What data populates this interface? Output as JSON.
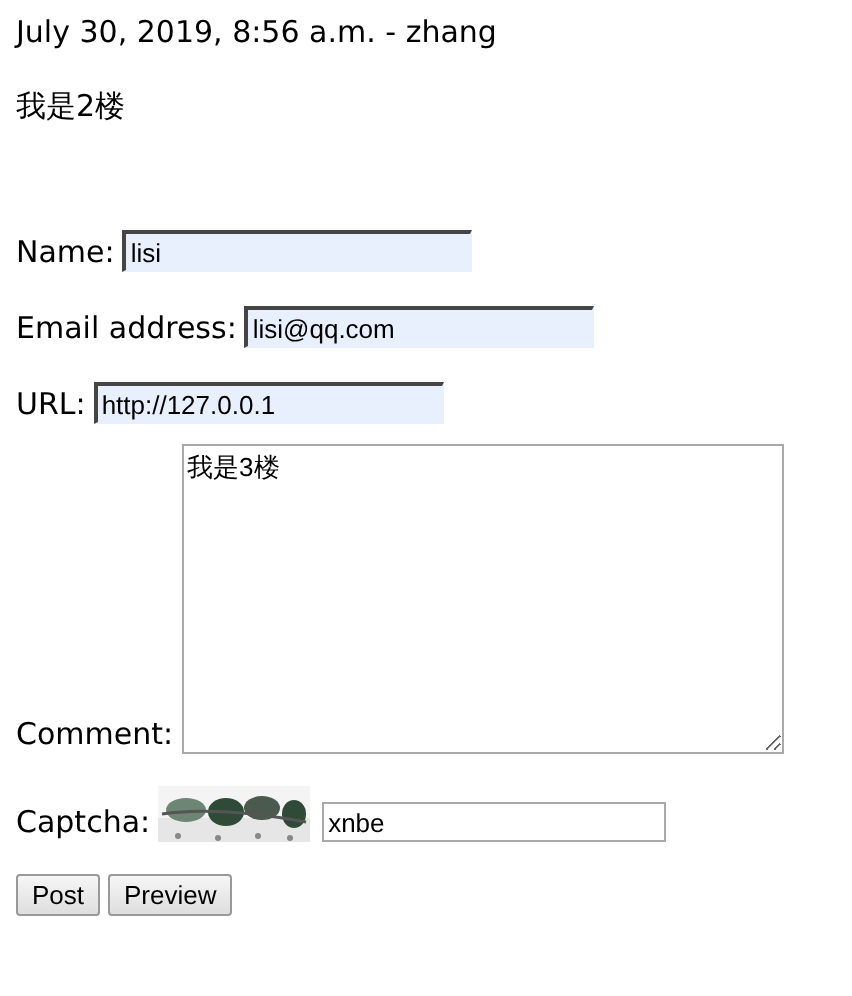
{
  "header": {
    "meta": "July 30, 2019, 8:56 a.m. - zhang",
    "comment": "我是2楼"
  },
  "form": {
    "fields": [
      {
        "label": "Name:",
        "value": "lisi",
        "autofilled": true
      },
      {
        "label": "Email address:",
        "value": "lisi@qq.com",
        "autofilled": true
      },
      {
        "label": "URL:",
        "value": "http://127.0.0.1",
        "autofilled": true
      }
    ],
    "comment": {
      "label": "Comment:",
      "value": "我是3楼"
    },
    "captcha": {
      "label": "Captcha:",
      "value": "xnbe"
    },
    "buttons": [
      "Post",
      "Preview"
    ]
  }
}
